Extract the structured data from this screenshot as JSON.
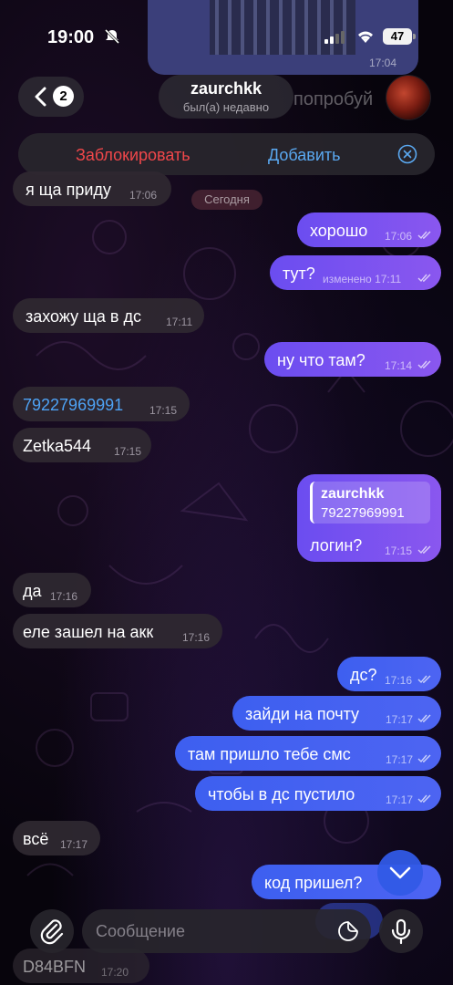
{
  "status_bar": {
    "time": "19:00",
    "battery": "47"
  },
  "header": {
    "back_count": "2",
    "contact_name": "zaurchkk",
    "contact_status": "был(а) недавно",
    "behind_text": "попробуй"
  },
  "action_bar": {
    "block_label": "Заблокировать",
    "add_label": "Добавить"
  },
  "qr_time": "17:04",
  "today_label": "Сегодня",
  "messages": [
    {
      "text": "я ща приду",
      "time": "17:06"
    },
    {
      "text": "хорошо",
      "time": "17:06"
    },
    {
      "text": "тут?",
      "time": "изменено 17:11"
    },
    {
      "text": "захожу ща в дс",
      "time": "17:11"
    },
    {
      "text": "ну что там?",
      "time": "17:14"
    },
    {
      "text": "79227969991",
      "time": "17:15"
    },
    {
      "text": "Zetka544",
      "time": "17:15"
    },
    {
      "quote_name": "zaurchkk",
      "quote_text": "79227969991",
      "text": "логин?",
      "time": "17:15"
    },
    {
      "text": "да",
      "time": "17:16"
    },
    {
      "text": "еле зашел на акк",
      "time": "17:16"
    },
    {
      "text": "дс?",
      "time": "17:16"
    },
    {
      "text": "зайди на почту",
      "time": "17:17"
    },
    {
      "text": "там пришло тебе смс",
      "time": "17:17"
    },
    {
      "text": "чтобы в дс пустило",
      "time": "17:17"
    },
    {
      "text": "всё",
      "time": "17:17"
    },
    {
      "text": "код пришел?",
      "time": ""
    },
    {
      "text": "D84BFN",
      "time": "17:20"
    }
  ],
  "input": {
    "placeholder": "Сообщение"
  },
  "colors": {
    "outgoing": "#7a52f0",
    "outgoing_blue": "#4560f1",
    "incoming": "#2e2830",
    "block": "#f0474a",
    "add": "#5aa8f0"
  },
  "icons": [
    "bell-slash-icon",
    "signal-icon",
    "wifi-icon",
    "battery-icon",
    "chevron-left-icon",
    "close-circle-icon",
    "double-check-icon",
    "chevron-down-icon",
    "paperclip-icon",
    "sticker-icon",
    "microphone-icon"
  ]
}
